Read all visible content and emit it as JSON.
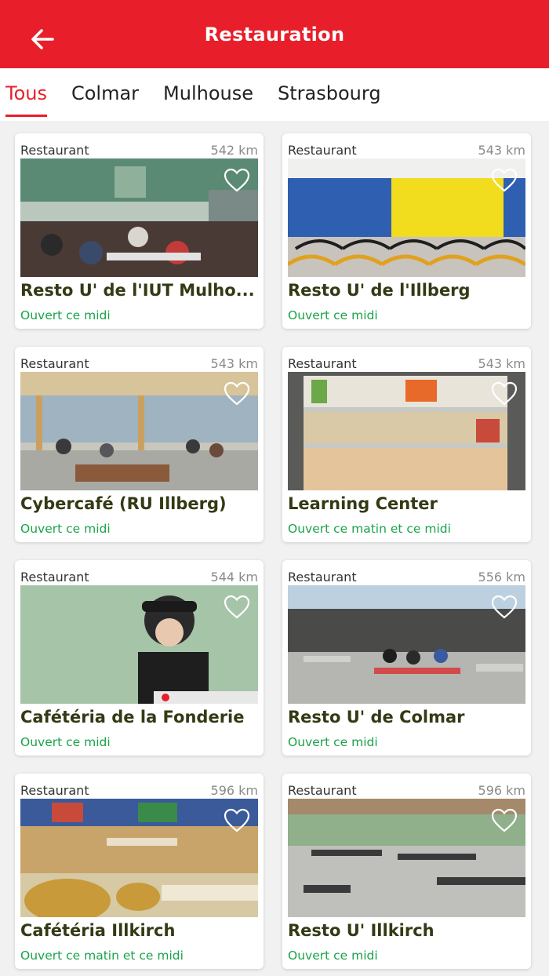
{
  "header": {
    "title": "Restauration",
    "back_icon": "arrow-left-icon"
  },
  "tabs": [
    {
      "label": "Tous",
      "active": true
    },
    {
      "label": "Colmar",
      "active": false
    },
    {
      "label": "Mulhouse",
      "active": false
    },
    {
      "label": "Strasbourg",
      "active": false
    }
  ],
  "colors": {
    "brand": "#e81e2a",
    "status": "#1aa34a",
    "title": "#333a14"
  },
  "restaurants": [
    {
      "type": "Restaurant",
      "distance": "542 km",
      "name": "Resto U' de l'IUT Mulho...",
      "status": "Ouvert ce midi",
      "favorite_icon": "heart-outline-icon"
    },
    {
      "type": "Restaurant",
      "distance": "543 km",
      "name": "Resto U' de l'Illberg",
      "status": "Ouvert ce midi",
      "favorite_icon": "heart-outline-icon"
    },
    {
      "type": "Restaurant",
      "distance": "543 km",
      "name": "Cybercafé (RU Illberg)",
      "status": "Ouvert ce midi",
      "favorite_icon": "heart-outline-icon"
    },
    {
      "type": "Restaurant",
      "distance": "543 km",
      "name": "Learning Center",
      "status": "Ouvert ce matin et ce midi",
      "favorite_icon": "heart-outline-icon"
    },
    {
      "type": "Restaurant",
      "distance": "544 km",
      "name": "Cafétéria de la Fonderie",
      "status": "Ouvert ce midi",
      "favorite_icon": "heart-outline-icon"
    },
    {
      "type": "Restaurant",
      "distance": "556 km",
      "name": "Resto U' de Colmar",
      "status": "Ouvert ce midi",
      "favorite_icon": "heart-outline-icon"
    },
    {
      "type": "Restaurant",
      "distance": "596 km",
      "name": "Cafétéria Illkirch",
      "status": "Ouvert ce matin et ce midi",
      "favorite_icon": "heart-outline-icon"
    },
    {
      "type": "Restaurant",
      "distance": "596 km",
      "name": "Resto U' Illkirch",
      "status": "Ouvert ce midi",
      "favorite_icon": "heart-outline-icon"
    }
  ]
}
